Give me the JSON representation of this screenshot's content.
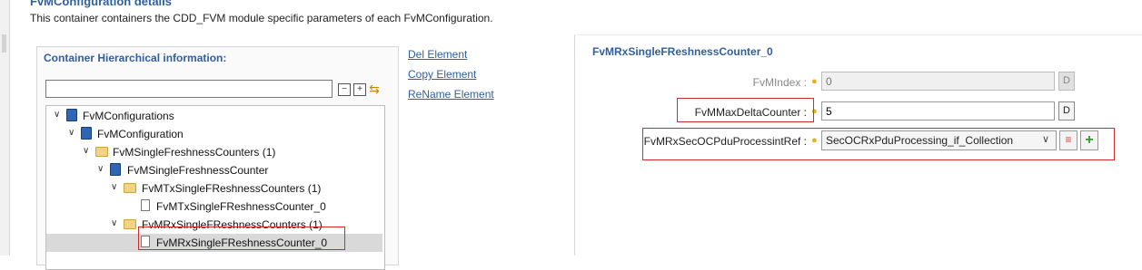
{
  "header": {
    "title": "FvMConfiguration details",
    "description": "This container containers the CDD_FVM module specific parameters of each FvMConfiguration."
  },
  "left_panel": {
    "title": "Container Hierarchical information:",
    "filter_value": "",
    "toolbar_icons": [
      "collapse-all-icon",
      "expand-all-icon",
      "link-editor-icon"
    ]
  },
  "tree": [
    {
      "label": "FvMConfigurations",
      "icon": "module-icon",
      "expanded": true
    },
    {
      "label": "FvMConfiguration",
      "icon": "module-icon",
      "expanded": true
    },
    {
      "label": "FvMSingleFreshnessCounters (1)",
      "icon": "folder-icon",
      "expanded": true
    },
    {
      "label": "FvMSingleFreshnessCounter",
      "icon": "module-icon",
      "expanded": true
    },
    {
      "label": "FvMTxSingleFReshnessCounters (1)",
      "icon": "folder-icon",
      "expanded": true
    },
    {
      "label": "FvMTxSingleFReshnessCounter_0",
      "icon": "document-icon"
    },
    {
      "label": "FvMRxSingleFReshnessCounters (1)",
      "icon": "folder-icon",
      "expanded": true
    },
    {
      "label": "FvMRxSingleFReshnessCounter_0",
      "icon": "document-icon",
      "selected": true
    }
  ],
  "actions": {
    "del": "Del Element",
    "copy": "Copy Element",
    "rename": "ReName Element"
  },
  "right_panel": {
    "title": "FvMRxSingleFReshnessCounter_0",
    "params": {
      "fvmindex": {
        "label": "FvMIndex :",
        "value": "0",
        "button": "D",
        "enabled": false
      },
      "maxdelta": {
        "label": "FvMMaxDeltaCounter :",
        "value": "5",
        "button": "D",
        "enabled": true
      },
      "secoc": {
        "label": "FvMRxSecOCPduProcessintRef :",
        "value": "SecOCRxPduProcessing_if_Collection"
      }
    }
  },
  "colors": {
    "accent": "#2f5f9e",
    "highlight": "#d42a2a"
  }
}
